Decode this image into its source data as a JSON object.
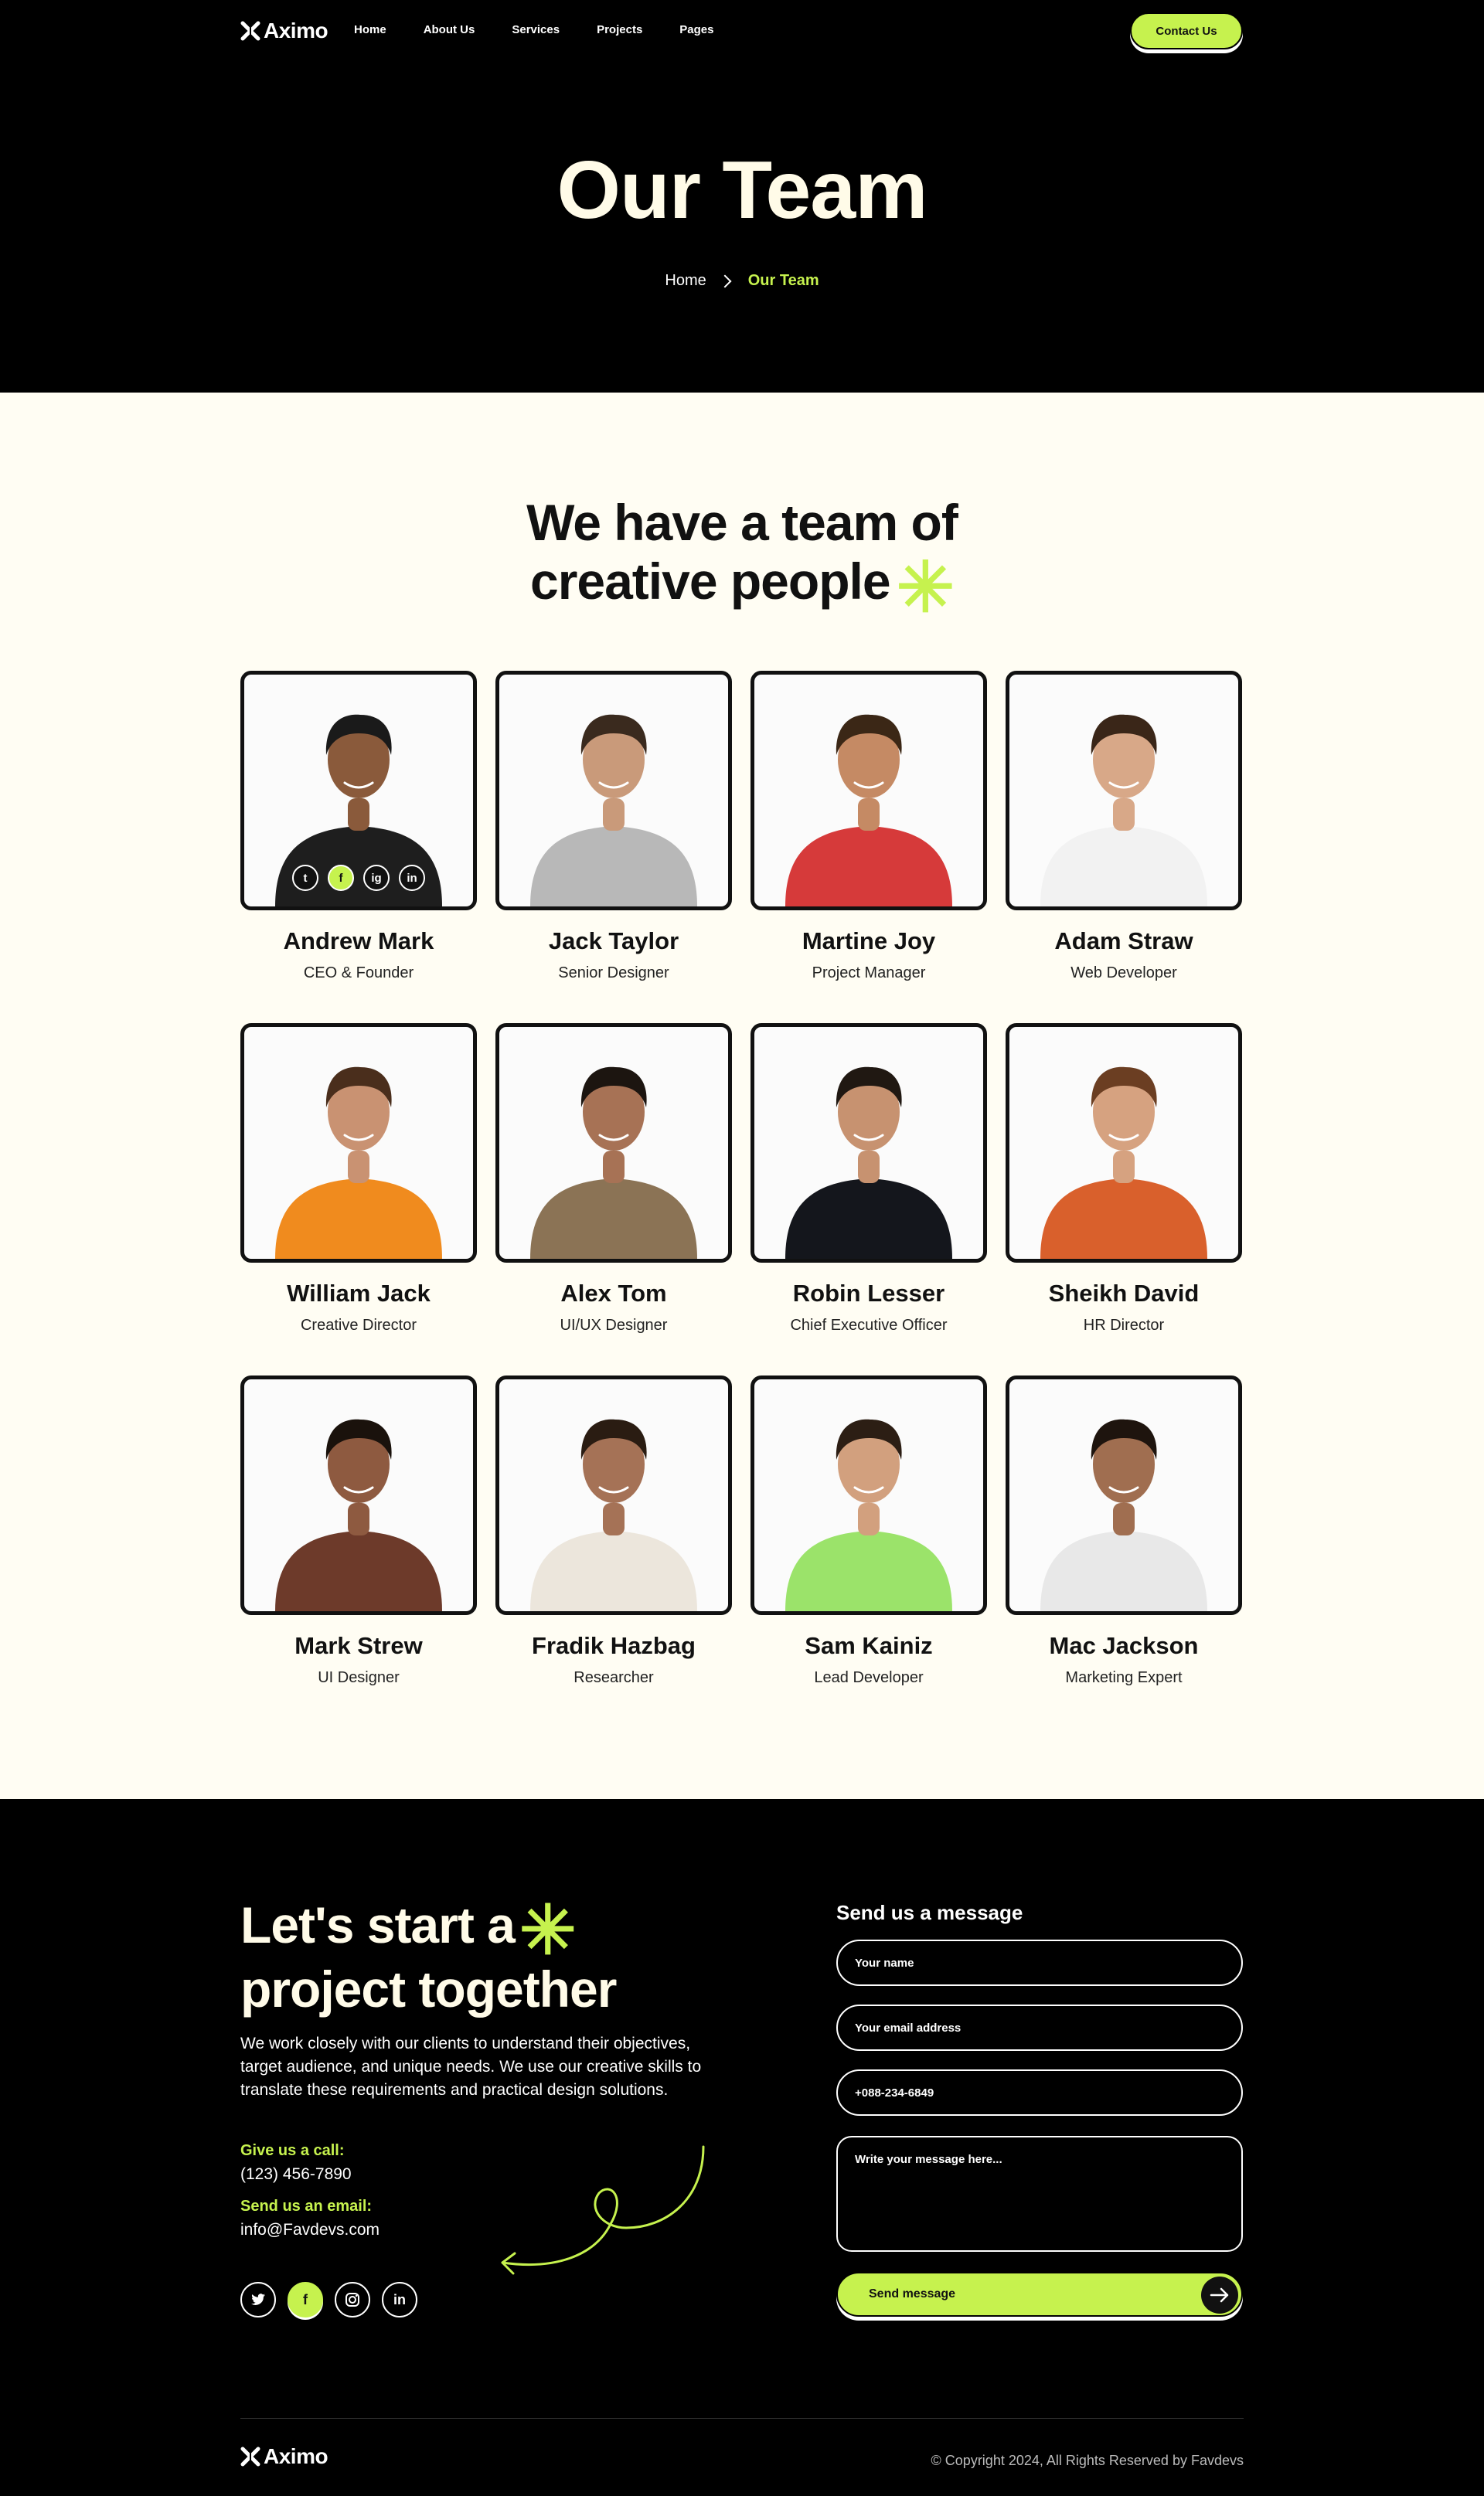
{
  "brand": {
    "name": "Aximo"
  },
  "nav": {
    "links": [
      "Home",
      "About Us",
      "Services",
      "Projects",
      "Pages"
    ],
    "contact_label": "Contact Us"
  },
  "hero": {
    "title": "Our Team",
    "breadcrumb": {
      "home": "Home",
      "current": "Our Team"
    }
  },
  "team": {
    "heading_line1": "We have a team of",
    "heading_line2": "creative people",
    "members": [
      {
        "name": "Andrew Mark",
        "role": "CEO & Founder",
        "shirt": "#1e1e1e",
        "skin": "#8a5a3b",
        "hair": "#1a1a1a"
      },
      {
        "name": "Jack Taylor",
        "role": "Senior Designer",
        "shirt": "#b8b8b8",
        "skin": "#c99a7a",
        "hair": "#3a2a1e"
      },
      {
        "name": "Martine Joy",
        "role": "Project Manager",
        "shirt": "#d63a3a",
        "skin": "#c58a64",
        "hair": "#3b2716"
      },
      {
        "name": "Adam Straw",
        "role": "Web Developer",
        "shirt": "#f2f2f2",
        "skin": "#d8a888",
        "hair": "#3a2618"
      },
      {
        "name": "William Jack",
        "role": "Creative Director",
        "shirt": "#f08b1e",
        "skin": "#c99272",
        "hair": "#4a2e1c"
      },
      {
        "name": "Alex Tom",
        "role": "UI/UX Designer",
        "shirt": "#8b7355",
        "skin": "#a77255",
        "hair": "#1c1510"
      },
      {
        "name": "Robin Lesser",
        "role": "Chief Executive Officer",
        "shirt": "#14161c",
        "skin": "#c79270",
        "hair": "#201812"
      },
      {
        "name": "Sheikh David",
        "role": "HR Director",
        "shirt": "#d9602c",
        "skin": "#d6a280",
        "hair": "#6b3e22"
      },
      {
        "name": "Mark Strew",
        "role": "UI Designer",
        "shirt": "#6d3a2a",
        "skin": "#8e5a40",
        "hair": "#1a120c"
      },
      {
        "name": "Fradik Hazbag",
        "role": "Researcher",
        "shirt": "#ece6dc",
        "skin": "#a57256",
        "hair": "#2a1c12"
      },
      {
        "name": "Sam Kainiz",
        "role": "Lead Developer",
        "shirt": "#9be36a",
        "skin": "#d2a07e",
        "hair": "#2c1e14"
      },
      {
        "name": "Mac Jackson",
        "role": "Marketing Expert",
        "shirt": "#e8e8e8",
        "skin": "#a06e50",
        "hair": "#1e140e"
      }
    ],
    "overlay_socials": [
      "t",
      "f",
      "ig",
      "in"
    ]
  },
  "contact": {
    "title_line1": "Let's start a",
    "title_line2": "project together",
    "description": "We work closely with our clients to understand their objectives, target audience, and unique needs. We use our creative skills to translate these requirements and practical design solutions.",
    "call_label": "Give us a call:",
    "call_value": "(123) 456-7890",
    "email_label": "Send us an email:",
    "email_value": "info@Favdevs.com",
    "socials": [
      "twitter-icon",
      "facebook-icon",
      "instagram-icon",
      "linkedin-icon"
    ]
  },
  "form": {
    "title": "Send us a message",
    "name_placeholder": "Your name",
    "email_placeholder": "Your email address",
    "phone_placeholder": "+088-234-6849",
    "message_placeholder": "Write your message here...",
    "submit_label": "Send message"
  },
  "footer": {
    "copyright": "© Copyright 2024, All Rights Reserved by Favdevs"
  },
  "colors": {
    "accent": "#c6f24e",
    "dark": "#000000",
    "cream": "#fffdf3"
  }
}
